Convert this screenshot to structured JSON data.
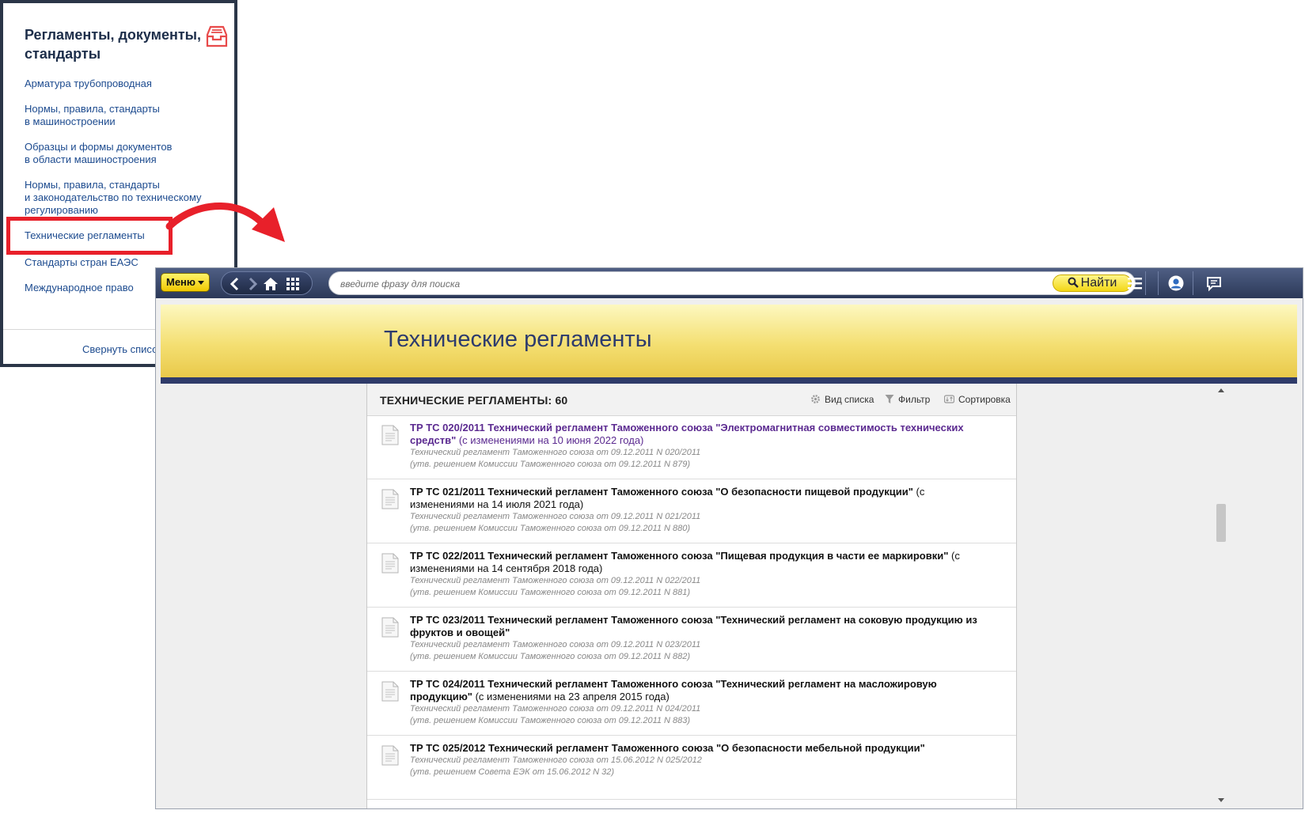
{
  "sidebar": {
    "title": "Регламенты, документы, стандарты",
    "items": [
      {
        "label": "Арматура трубопроводная"
      },
      {
        "label": "Нормы, правила, стандарты\nв машиностроении"
      },
      {
        "label": "Образцы и формы документов\nв области машиностроения"
      },
      {
        "label": "Нормы, правила, стандарты\nи законодательство по техническому\nрегулированию"
      },
      {
        "label": "Технические регламенты"
      },
      {
        "label": "Стандарты стран ЕАЭС"
      },
      {
        "label": "Международное право"
      }
    ],
    "collapse_label": "Свернуть список",
    "highlighted_item": "Технические регламенты"
  },
  "toolbar": {
    "menu_label": "Меню",
    "search_placeholder": "введите фразу для поиска",
    "search_button": "Найти",
    "icons": [
      "chevron-left-icon",
      "chevron-right-icon",
      "home-icon",
      "grid-icon",
      "hamburger-icon",
      "user-icon",
      "chat-icon"
    ]
  },
  "banner": {
    "title": "Технические регламенты"
  },
  "list": {
    "title": "ТЕХНИЧЕСКИЕ РЕГЛАМЕНТЫ: 60",
    "actions": {
      "view": "Вид списка",
      "filter": "Фильтр",
      "sort": "Сортировка"
    },
    "items": [
      {
        "title": "ТР ТС 020/2011 Технический регламент Таможенного союза \"Электромагнитная совместимость технических средств\"",
        "note": " (с изменениями на 10 июня 2022 года)",
        "meta1": "Технический регламент Таможенного союза от 09.12.2011 N 020/2011",
        "meta2": "(утв. решением Комиссии Таможенного союза от 09.12.2011 N 879)",
        "visited": true
      },
      {
        "title": "ТР ТС 021/2011 Технический регламент Таможенного союза \"О безопасности пищевой продукции\"",
        "note": " (с изменениями на 14 июля 2021 года)",
        "meta1": "Технический регламент Таможенного союза от 09.12.2011 N 021/2011",
        "meta2": "(утв. решением Комиссии Таможенного союза от 09.12.2011 N 880)",
        "visited": false
      },
      {
        "title": "ТР ТС 022/2011 Технический регламент Таможенного союза \"Пищевая продукция в части ее маркировки\"",
        "note": " (с изменениями на 14 сентября 2018 года)",
        "meta1": "Технический регламент Таможенного союза от 09.12.2011 N 022/2011",
        "meta2": "(утв. решением Комиссии Таможенного союза от 09.12.2011 N 881)",
        "visited": false
      },
      {
        "title": "ТР ТС 023/2011 Технический регламент Таможенного союза \"Технический регламент на соковую продукцию из фруктов и овощей\"",
        "note": "",
        "meta1": "Технический регламент Таможенного союза от 09.12.2011 N 023/2011",
        "meta2": "(утв. решением Комиссии Таможенного союза от 09.12.2011 N 882)",
        "visited": false
      },
      {
        "title": "ТР ТС 024/2011 Технический регламент Таможенного союза \"Технический регламент на масложировую продукцию\"",
        "note": " (с изменениями на 23 апреля 2015 года)",
        "meta1": "Технический регламент Таможенного союза от 09.12.2011 N 024/2011",
        "meta2": "(утв. решением Комиссии Таможенного союза от 09.12.2011 N 883)",
        "visited": false
      },
      {
        "title": "ТР ТС 025/2012 Технический регламент Таможенного союза \"О безопасности мебельной продукции\"",
        "note": "",
        "meta1": "Технический регламент Таможенного союза от 15.06.2012 N 025/2012",
        "meta2": "(утв. решением Совета ЕЭК от 15.06.2012 N 32)",
        "visited": false
      }
    ]
  },
  "colors": {
    "accent_red": "#e8202a",
    "banner_yellow": "#f4df72",
    "navy": "#2f3b6a",
    "visited_link": "#5b2a90"
  }
}
